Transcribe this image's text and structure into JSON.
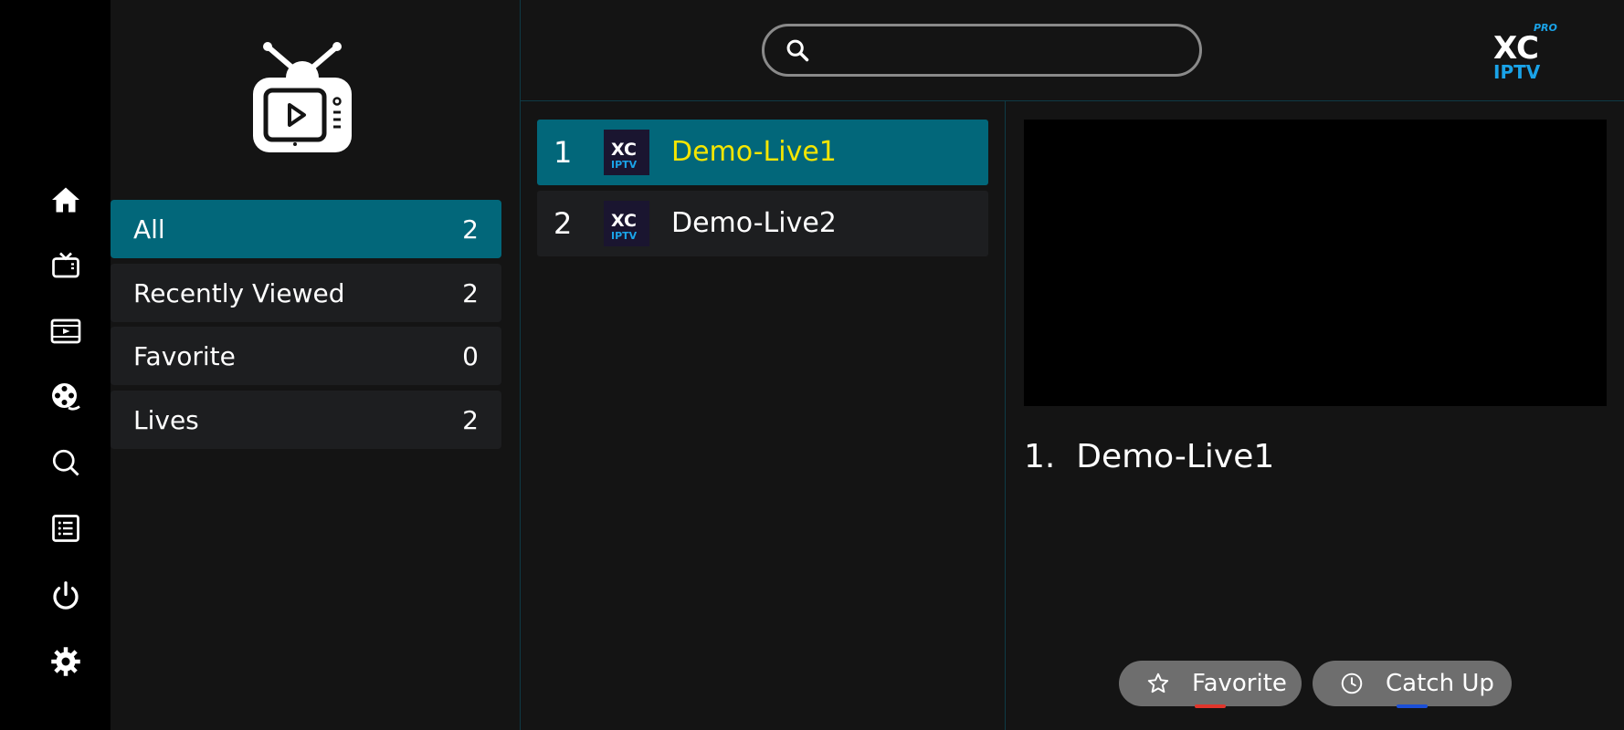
{
  "sidebar": {
    "items": [
      {
        "icon": "home-icon"
      },
      {
        "icon": "live-tv-icon"
      },
      {
        "icon": "movies-icon"
      },
      {
        "icon": "series-reel-icon"
      },
      {
        "icon": "search-icon"
      },
      {
        "icon": "list-icon"
      },
      {
        "icon": "power-icon"
      },
      {
        "icon": "gear-icon"
      }
    ]
  },
  "categories": [
    {
      "label": "All",
      "count": "2"
    },
    {
      "label": "Recently Viewed",
      "count": "2"
    },
    {
      "label": "Favorite",
      "count": "0"
    },
    {
      "label": "Lives",
      "count": "2"
    }
  ],
  "search": {
    "value": "",
    "placeholder": ""
  },
  "brand": {
    "line1": "XC",
    "line2": "IPTV",
    "badge": "PRO"
  },
  "channels": [
    {
      "number": "1",
      "name": "Demo-Live1",
      "thumb_line1": "XC",
      "thumb_line2": "IPTV"
    },
    {
      "number": "2",
      "name": "Demo-Live2",
      "thumb_line1": "XC",
      "thumb_line2": "IPTV"
    }
  ],
  "now_playing": {
    "label": "1.  Demo-Live1"
  },
  "actions": {
    "favorite_label": "Favorite",
    "catchup_label": "Catch Up"
  },
  "colors": {
    "accent": "#02677a",
    "selected_text": "#f5e600",
    "brand_blue": "#1aa3e8",
    "favorite_key": "#e0352b",
    "catchup_key": "#1b4fd6"
  }
}
